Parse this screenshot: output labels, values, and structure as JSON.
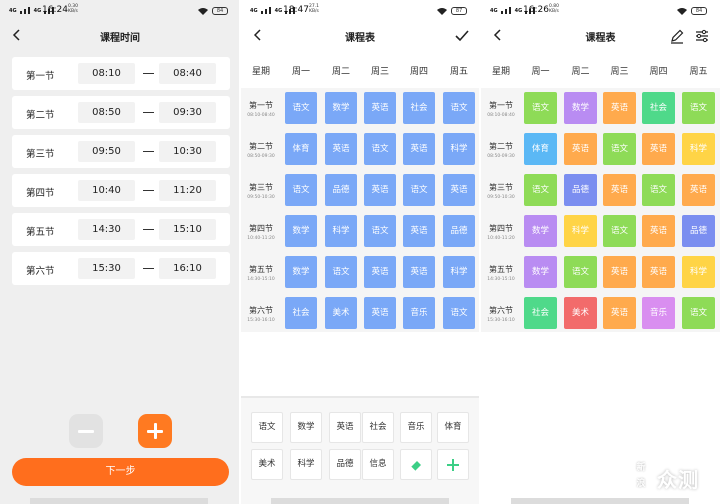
{
  "colors": {
    "accent": "#ff7a21",
    "blue_cell": "#7aa8f7",
    "page_bg": "#efefef"
  },
  "status_bars": [
    {
      "time": "16:24",
      "speed": "0.30\nKB/s",
      "battery": "84"
    },
    {
      "time": "18:47",
      "speed": "27.1\nKB/s",
      "battery": "87"
    },
    {
      "time": "16:26",
      "speed": "0.80\nKB/s",
      "battery": "84"
    }
  ],
  "time_screen": {
    "title": "课程时间",
    "rows": [
      {
        "label": "第一节",
        "start": "08:10",
        "end": "08:40"
      },
      {
        "label": "第二节",
        "start": "08:50",
        "end": "09:30"
      },
      {
        "label": "第三节",
        "start": "09:50",
        "end": "10:30"
      },
      {
        "label": "第四节",
        "start": "10:40",
        "end": "11:20"
      },
      {
        "label": "第五节",
        "start": "14:30",
        "end": "15:10"
      },
      {
        "label": "第六节",
        "start": "15:30",
        "end": "16:10"
      }
    ],
    "next_label": "下一步"
  },
  "schedule": {
    "title": "课程表",
    "header_label": "星期",
    "days": [
      "周一",
      "周二",
      "周三",
      "周四",
      "周五"
    ],
    "periods": [
      {
        "name": "第一节",
        "time": "08:10-08:40"
      },
      {
        "name": "第二节",
        "time": "08:50-09:30"
      },
      {
        "name": "第三节",
        "time": "09:50-10:30"
      },
      {
        "name": "第四节",
        "time": "10:40-11:20"
      },
      {
        "name": "第五节",
        "time": "14:30-15:10"
      },
      {
        "name": "第六节",
        "time": "15:30-16:10"
      }
    ],
    "grid": [
      [
        "语文",
        "数学",
        "英语",
        "社会",
        "语文"
      ],
      [
        "体育",
        "英语",
        "语文",
        "英语",
        "科学"
      ],
      [
        "语文",
        "品德",
        "英语",
        "语文",
        "英语"
      ],
      [
        "数学",
        "科学",
        "语文",
        "英语",
        "品德"
      ],
      [
        "数学",
        "语文",
        "英语",
        "英语",
        "科学"
      ],
      [
        "社会",
        "美术",
        "英语",
        "音乐",
        "语文"
      ]
    ],
    "palette_row1": [
      "语文",
      "数学",
      "英语",
      "社会",
      "音乐",
      "体育"
    ],
    "palette_row2": [
      "美术",
      "科学",
      "品德",
      "信息"
    ],
    "subject_colors": {
      "语文": "#8edb57",
      "数学": "#b98cf2",
      "英语": "#ffaa4d",
      "社会": "#4fd98a",
      "体育": "#5bb8f5",
      "科学": "#ffd446",
      "品德": "#7b8ef0",
      "美术": "#f26b6b",
      "音乐": "#d98ef0"
    }
  },
  "watermark": {
    "logo": "新\n浪",
    "text": "众测"
  }
}
